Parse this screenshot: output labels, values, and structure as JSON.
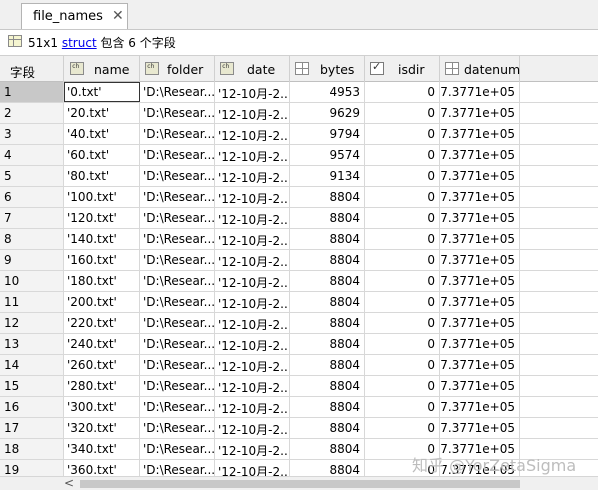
{
  "tab": {
    "title": "file_names",
    "close": "✕"
  },
  "info": {
    "size": "51x1",
    "type_link": "struct",
    "desc": "包含 6 个字段"
  },
  "columns": {
    "index": "字段",
    "name": "name",
    "folder": "folder",
    "date": "date",
    "bytes": "bytes",
    "isdir": "isdir",
    "datenum": "datenum"
  },
  "column_icons": {
    "name": "char-array-icon",
    "folder": "char-array-icon",
    "date": "char-array-icon",
    "bytes": "numeric-array-icon",
    "isdir": "logical-checkbox-icon",
    "datenum": "numeric-array-icon"
  },
  "rows": [
    {
      "i": "1",
      "name": "'0.txt'",
      "folder": "'D:\\Resear...",
      "date": "'12-10月-2...",
      "bytes": "4953",
      "isdir": "0",
      "datenum": "7.3771e+05"
    },
    {
      "i": "2",
      "name": "'20.txt'",
      "folder": "'D:\\Resear...",
      "date": "'12-10月-2...",
      "bytes": "9629",
      "isdir": "0",
      "datenum": "7.3771e+05"
    },
    {
      "i": "3",
      "name": "'40.txt'",
      "folder": "'D:\\Resear...",
      "date": "'12-10月-2...",
      "bytes": "9794",
      "isdir": "0",
      "datenum": "7.3771e+05"
    },
    {
      "i": "4",
      "name": "'60.txt'",
      "folder": "'D:\\Resear...",
      "date": "'12-10月-2...",
      "bytes": "9574",
      "isdir": "0",
      "datenum": "7.3771e+05"
    },
    {
      "i": "5",
      "name": "'80.txt'",
      "folder": "'D:\\Resear...",
      "date": "'12-10月-2...",
      "bytes": "9134",
      "isdir": "0",
      "datenum": "7.3771e+05"
    },
    {
      "i": "6",
      "name": "'100.txt'",
      "folder": "'D:\\Resear...",
      "date": "'12-10月-2...",
      "bytes": "8804",
      "isdir": "0",
      "datenum": "7.3771e+05"
    },
    {
      "i": "7",
      "name": "'120.txt'",
      "folder": "'D:\\Resear...",
      "date": "'12-10月-2...",
      "bytes": "8804",
      "isdir": "0",
      "datenum": "7.3771e+05"
    },
    {
      "i": "8",
      "name": "'140.txt'",
      "folder": "'D:\\Resear...",
      "date": "'12-10月-2...",
      "bytes": "8804",
      "isdir": "0",
      "datenum": "7.3771e+05"
    },
    {
      "i": "9",
      "name": "'160.txt'",
      "folder": "'D:\\Resear...",
      "date": "'12-10月-2...",
      "bytes": "8804",
      "isdir": "0",
      "datenum": "7.3771e+05"
    },
    {
      "i": "10",
      "name": "'180.txt'",
      "folder": "'D:\\Resear...",
      "date": "'12-10月-2...",
      "bytes": "8804",
      "isdir": "0",
      "datenum": "7.3771e+05"
    },
    {
      "i": "11",
      "name": "'200.txt'",
      "folder": "'D:\\Resear...",
      "date": "'12-10月-2...",
      "bytes": "8804",
      "isdir": "0",
      "datenum": "7.3771e+05"
    },
    {
      "i": "12",
      "name": "'220.txt'",
      "folder": "'D:\\Resear...",
      "date": "'12-10月-2...",
      "bytes": "8804",
      "isdir": "0",
      "datenum": "7.3771e+05"
    },
    {
      "i": "13",
      "name": "'240.txt'",
      "folder": "'D:\\Resear...",
      "date": "'12-10月-2...",
      "bytes": "8804",
      "isdir": "0",
      "datenum": "7.3771e+05"
    },
    {
      "i": "14",
      "name": "'260.txt'",
      "folder": "'D:\\Resear...",
      "date": "'12-10月-2...",
      "bytes": "8804",
      "isdir": "0",
      "datenum": "7.3771e+05"
    },
    {
      "i": "15",
      "name": "'280.txt'",
      "folder": "'D:\\Resear...",
      "date": "'12-10月-2...",
      "bytes": "8804",
      "isdir": "0",
      "datenum": "7.3771e+05"
    },
    {
      "i": "16",
      "name": "'300.txt'",
      "folder": "'D:\\Resear...",
      "date": "'12-10月-2...",
      "bytes": "8804",
      "isdir": "0",
      "datenum": "7.3771e+05"
    },
    {
      "i": "17",
      "name": "'320.txt'",
      "folder": "'D:\\Resear...",
      "date": "'12-10月-2...",
      "bytes": "8804",
      "isdir": "0",
      "datenum": "7.3771e+05"
    },
    {
      "i": "18",
      "name": "'340.txt'",
      "folder": "'D:\\Resear...",
      "date": "'12-10月-2...",
      "bytes": "8804",
      "isdir": "0",
      "datenum": "7.3771e+05"
    },
    {
      "i": "19",
      "name": "'360.txt'",
      "folder": "'D:\\Resear...",
      "date": "'12-10月-2...",
      "bytes": "8804",
      "isdir": "0",
      "datenum": "7.3771e+05"
    }
  ],
  "scrollbar": {
    "left_arrow": "<"
  },
  "watermark": "知乎 @YorZetaSigma"
}
